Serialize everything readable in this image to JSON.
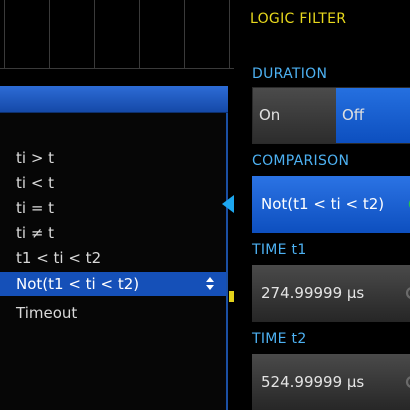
{
  "panel": {
    "title": "LOGIC FILTER",
    "duration": {
      "label": "DURATION",
      "on_label": "On",
      "off_label": "Off",
      "selected": "Off"
    },
    "comparison": {
      "label": "COMPARISON",
      "value": "Not(t1 < ti < t2)",
      "icon": "cycle-icon"
    },
    "time_t1": {
      "label": "TIME t1",
      "value": "274.99999 µs",
      "icon": "cycle-icon"
    },
    "time_t2": {
      "label": "TIME t2",
      "value": "524.99999 µs",
      "icon": "cycle-icon"
    }
  },
  "dropdown": {
    "options": [
      "ti > t",
      "ti < t",
      "ti = t",
      "ti ≠ t",
      "t1 < ti < t2",
      "Not(t1 < ti < t2)",
      "Timeout"
    ],
    "selected_index": 5,
    "selected_icon": "up-down-arrows-icon"
  },
  "colors": {
    "title_yellow": "#e8d91d",
    "label_blue": "#4db1f2",
    "selection_blue": "#1550b8",
    "cycle_green": "#27c24a",
    "pointer_blue": "#1da7f0",
    "marker_yellow": "#e3d11a"
  }
}
